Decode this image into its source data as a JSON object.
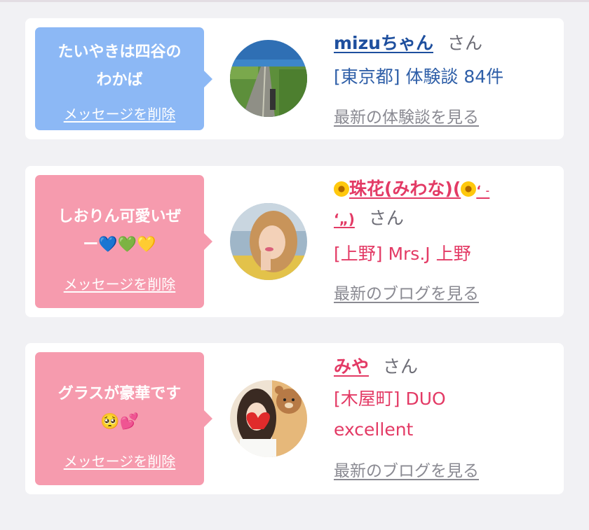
{
  "messages": [
    {
      "bubble_text_1": "たいやきは四谷の",
      "bubble_text_2": "わかば",
      "delete_label": "メッセージを削除",
      "name": "mizuちゃん",
      "honorific": "さん",
      "detail_line_1": "[東京都] 体験談 84件",
      "link_label": "最新の体験談を見る",
      "avatar_icon": "road-landscape-avatar"
    },
    {
      "bubble_text_1": "しおりん可愛いぜ",
      "bubble_text_2": "ー💙💚💛",
      "delete_label": "メッセージを削除",
      "name_main": "珠花(みわな)(",
      "name_tail": "‘ ˗",
      "name_line2": "‘„)",
      "honorific": "さん",
      "detail_line_1": "[上野] Mrs.J 上野",
      "link_label": "最新のブログを見る",
      "avatar_icon": "woman-portrait-avatar"
    },
    {
      "bubble_text_1": "グラスが豪華です",
      "bubble_text_2": "🥺💕",
      "delete_label": "メッセージを削除",
      "name": "みや",
      "honorific": "さん",
      "detail_line_1": "[木屋町] DUO",
      "detail_line_2": "excellent",
      "link_label": "最新のブログを見る",
      "avatar_icon": "woman-bear-avatar"
    }
  ],
  "colors": {
    "blue_bubble": "#8cb8f5",
    "pink_bubble": "#f69bae",
    "blue_text": "#2f5fa8",
    "pink_text": "#e33a65",
    "link_gray": "#8a8a92",
    "background": "#f1f1f4"
  }
}
